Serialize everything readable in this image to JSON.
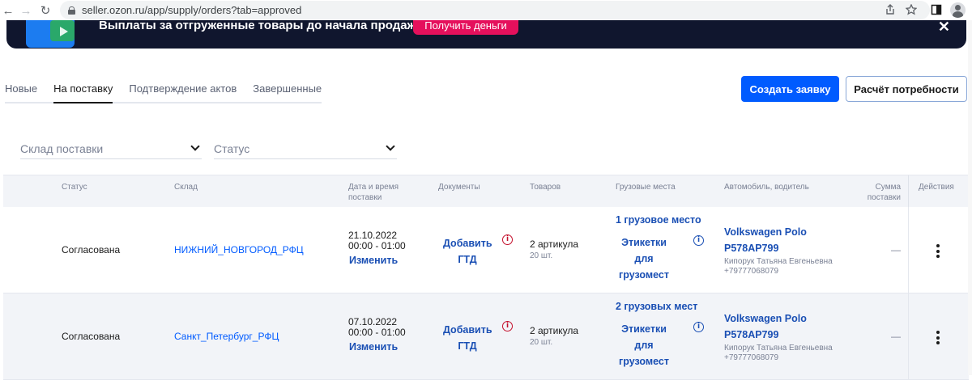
{
  "browser": {
    "url": "seller.ozon.ru/app/supply/orders?tab=approved",
    "back": "←",
    "forward": "→",
    "reload": "↻"
  },
  "banner": {
    "text": "Выплаты за отгруженные товары до начала продаж",
    "button": "Получить деньги",
    "close": "✕"
  },
  "tabs": [
    {
      "label": "Новые"
    },
    {
      "label": "На поставку"
    },
    {
      "label": "Подтверждение актов"
    },
    {
      "label": "Завершенные"
    }
  ],
  "actions": {
    "create": "Создать заявку",
    "calculate": "Расчёт потребности"
  },
  "filters": {
    "warehouse_placeholder": "Склад поставки",
    "status_placeholder": "Статус"
  },
  "table": {
    "headers": {
      "status": "Статус",
      "warehouse": "Склад",
      "datetime_l1": "Дата и время",
      "datetime_l2": "поставки",
      "documents": "Документы",
      "goods": "Товаров",
      "cargo": "Грузовые места",
      "car": "Автомобиль, водитель",
      "sum_l1": "Сумма",
      "sum_l2": "поставки",
      "actions": "Действия"
    },
    "rows": [
      {
        "status": "Согласована",
        "warehouse": "НИЖНИЙ_НОВГОРОД_РФЦ",
        "date": "21.10.2022",
        "time": "00:00 - 01:00",
        "edit": "Изменить",
        "doc_l1": "Добавить",
        "doc_l2": "ГТД",
        "goods": "2 артикула",
        "qty": "20 шт.",
        "cargo_count": "1 грузовое место",
        "labels_l1": "Этикетки",
        "labels_l2": "для",
        "labels_l3": "грузомест",
        "car_l1": "Volkswagen Polo",
        "car_l2": "Р578АР799",
        "driver": "Кипорук Татьяна Евгеньевна",
        "phone": "+79777068079",
        "sum": "—"
      },
      {
        "status": "Согласована",
        "warehouse": "Санкт_Петербург_РФЦ",
        "date": "07.10.2022",
        "time": "00:00 - 01:00",
        "edit": "Изменить",
        "doc_l1": "Добавить",
        "doc_l2": "ГТД",
        "goods": "2 артикула",
        "qty": "20 шт.",
        "cargo_count": "2 грузовых мест",
        "labels_l1": "Этикетки",
        "labels_l2": "для",
        "labels_l3": "грузомест",
        "car_l1": "Volkswagen Polo",
        "car_l2": "Р578АР799",
        "driver": "Кипорук Татьяна Евгеньевна",
        "phone": "+79777068079",
        "sum": "—"
      }
    ]
  },
  "colors": {
    "primary": "#005bff",
    "banner_bg": "#10162e",
    "banner_button": "#e5105c",
    "info_red": "#c4102c",
    "link_blue": "#1a4fb4"
  }
}
